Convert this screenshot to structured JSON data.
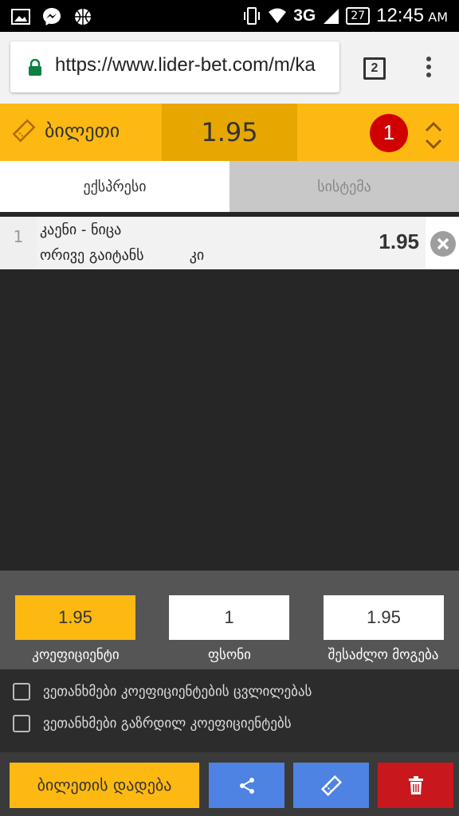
{
  "status_bar": {
    "network": "3G",
    "battery": "27",
    "time": "12:45",
    "ampm": "AM"
  },
  "browser": {
    "url": "https://www.lider-bet.com/m/ka",
    "tab_count": "2"
  },
  "ticket": {
    "label": "ბილეთი",
    "total_odds": "1.95",
    "count": "1"
  },
  "tabs": {
    "express": "ექსპრესი",
    "system": "სისტემა"
  },
  "bets": [
    {
      "index": "1",
      "match": "კაენი - ნიცა",
      "market": "ორივე გაიტანს          კი",
      "odds": "1.95"
    }
  ],
  "stake_panel": {
    "coef_value": "1.95",
    "coef_label": "კოეფიციენტი",
    "stake_value": "1",
    "stake_label": "ფსონი",
    "win_value": "1.95",
    "win_label": "შესაძლო მოგება"
  },
  "options": {
    "accept_odds_change": "ვეთანხმები კოეფიციენტების ცვლილებას",
    "accept_increased_odds": "ვეთანხმები გაზრდილ კოეფიციენტებს"
  },
  "actions": {
    "place_bet": "ბილეთის დადება"
  },
  "colors": {
    "accent": "#fdb912",
    "accent_dark": "#e7a700",
    "badge": "#d10000",
    "share_button": "#4e82e3",
    "delete_button": "#c8181e"
  }
}
